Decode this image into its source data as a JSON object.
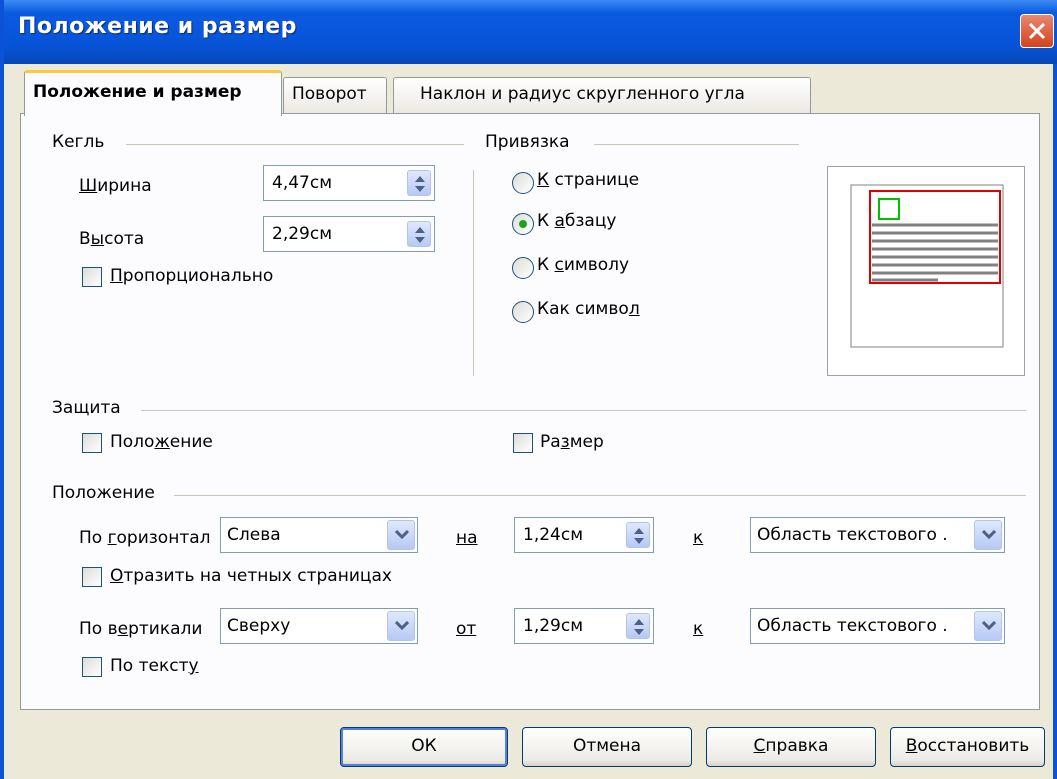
{
  "window": {
    "title": "Положение и размер"
  },
  "tabs": [
    {
      "label": "Положение и размер",
      "active": true
    },
    {
      "label": "Поворот",
      "active": false
    },
    {
      "label": "Наклон и радиус скругленного угла",
      "active": false
    }
  ],
  "size": {
    "group_label": "Кегль",
    "width_label_pre": "Ш",
    "width_label_post": "ирина",
    "width_value": "4,47см",
    "height_label_pre": "В",
    "height_label_mid": "ы",
    "height_label_post": "сота",
    "height_value": "2,29см",
    "proportional_pre": "",
    "proportional_u": "П",
    "proportional_post": "ропорционально",
    "proportional_checked": false
  },
  "anchor": {
    "group_label": "Привязка",
    "options": [
      {
        "pre": "",
        "u": "К",
        "post": " странице",
        "selected": false
      },
      {
        "pre": "К ",
        "u": "а",
        "post": "бзацу",
        "selected": true
      },
      {
        "pre": "К ",
        "u": "с",
        "post": "имволу",
        "selected": false
      },
      {
        "pre": "Как симво",
        "u": "л",
        "post": "",
        "selected": false
      }
    ]
  },
  "protect": {
    "group_label": "Защита",
    "position_pre": "Поло",
    "position_u": "ж",
    "position_post": "ение",
    "size_pre": "Ра",
    "size_u": "з",
    "size_post": "мер"
  },
  "position": {
    "group_label": "Положение",
    "horiz_label_pre": "По ",
    "horiz_label_u": "г",
    "horiz_label_post": "оризонтал",
    "horiz_value": "Слева",
    "by_label_h": "на",
    "horiz_offset": "1,24см",
    "to_label": "к",
    "horiz_ref": "Область текстового .",
    "mirror_pre": "",
    "mirror_u": "О",
    "mirror_post": "тразить на четных страницах",
    "vert_label_pre": "По в",
    "vert_label_u": "е",
    "vert_label_post": "ртикали",
    "vert_value": "Сверху",
    "by_label_v": "от",
    "vert_offset": "1,29см",
    "vert_ref": "Область текстового .",
    "follow_pre": "По текст",
    "follow_u": "у",
    "follow_post": ""
  },
  "buttons": {
    "ok": "ОК",
    "cancel": "Отмена",
    "help_pre": "",
    "help_u": "С",
    "help_post": "правка",
    "reset_pre": "",
    "reset_u": "В",
    "reset_post": "осстановить"
  },
  "colors": {
    "titlebar": "#0a5ae0",
    "accent_tab": "#ffc83c",
    "radio_dot": "#21a121",
    "preview_frame": "#e00000",
    "preview_object": "#00c000"
  }
}
